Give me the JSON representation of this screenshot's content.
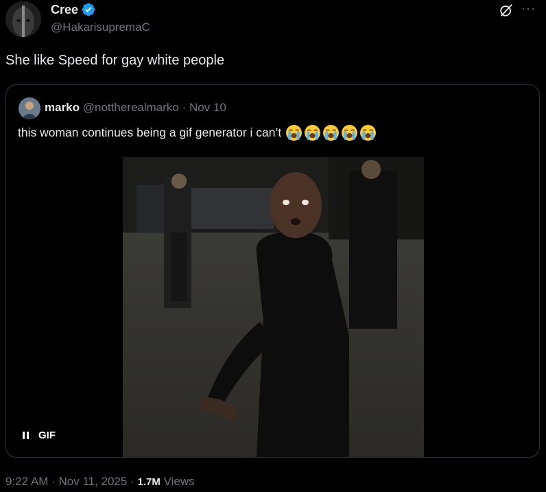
{
  "author": {
    "display_name": "Cree",
    "handle": "@HakarisupremaC",
    "verified_color": "#1d9bf0"
  },
  "tweet": {
    "text": "She like Speed for gay white people"
  },
  "quoted": {
    "display_name": "marko",
    "handle": "@nottherealmarko",
    "separator": "·",
    "date": "Nov 10",
    "text": "this woman continues being a gif generator i can’t",
    "emoji_name": "loudly-crying-face-icon",
    "emoji_count": 5,
    "media_badge": "GIF"
  },
  "footer": {
    "time": "9:22 AM",
    "sep1": "·",
    "date": "Nov 11, 2025",
    "sep2": "·",
    "views_count": "1.7M",
    "views_label": "Views"
  },
  "icons": [
    "verified-badge-icon",
    "grok-icon",
    "more-icon",
    "pause-icon"
  ],
  "colors": {
    "background": "#000000",
    "text_primary": "#e7e9ea",
    "text_secondary": "#71767b",
    "border": "#2f3336",
    "accent": "#1d9bf0"
  }
}
